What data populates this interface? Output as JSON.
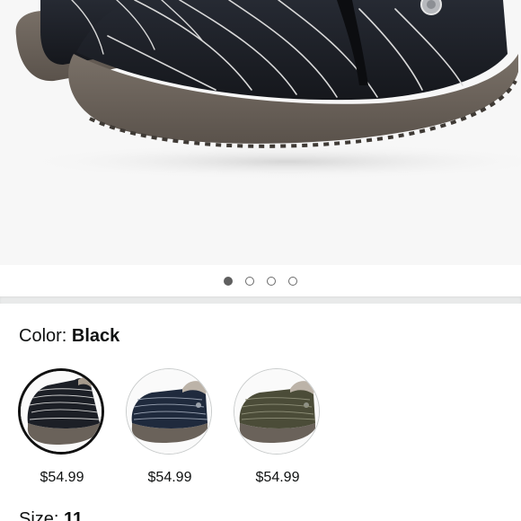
{
  "product": {
    "image_alt": "black slip-on winter ankle boot with quilted stripes",
    "carousel": {
      "total": 4,
      "active_index": 0
    }
  },
  "color": {
    "label": "Color:",
    "selected": "Black"
  },
  "variants": [
    {
      "name": "black-variant",
      "price": "$54.99",
      "selected": true
    },
    {
      "name": "navy-variant",
      "price": "$54.99",
      "selected": false
    },
    {
      "name": "olive-variant",
      "price": "$54.99",
      "selected": false
    }
  ],
  "size": {
    "label": "Size:",
    "selected": "11"
  },
  "colors": {
    "background": "#ffffff",
    "hero_background": "#f7f7f7",
    "boot_black": "#1c1f26",
    "boot_navy": "#1f2a3d",
    "boot_olive": "#4b4c38",
    "sole": "#6a625a",
    "dot_active": "#5f5f5f",
    "divider": "#e9eaea"
  }
}
